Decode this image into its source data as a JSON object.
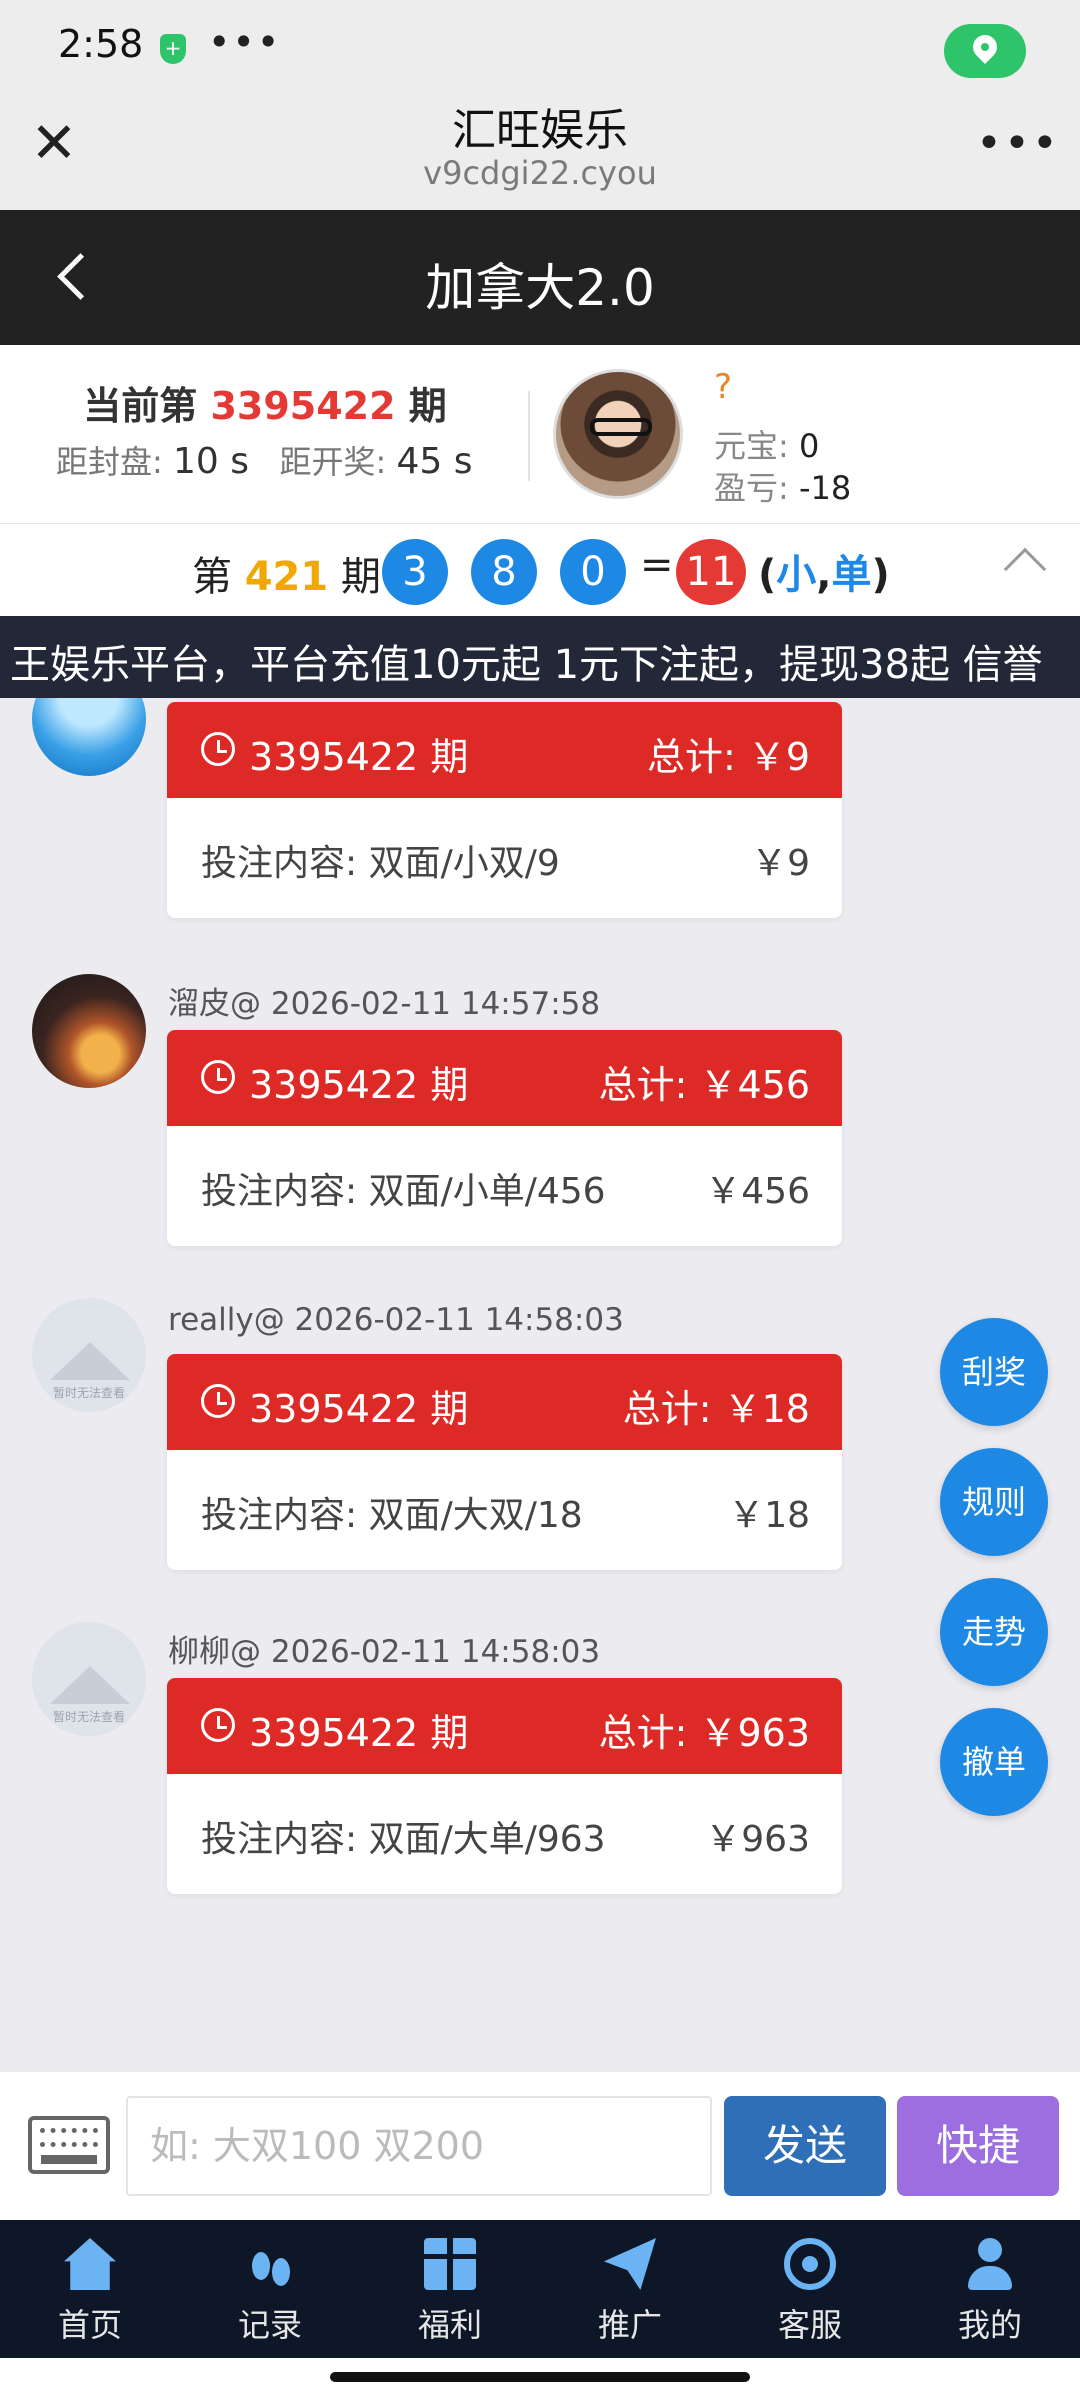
{
  "status": {
    "time": "2:58",
    "dots": "•••"
  },
  "wx": {
    "title": "汇旺娱乐",
    "domain": "v9cdgi22.cyou",
    "close": "✕",
    "more": "•••"
  },
  "nav": {
    "title": "加拿大2.0"
  },
  "info": {
    "period_prefix": "当前第",
    "period_num": "3395422",
    "period_suffix": "期",
    "close_label": "距封盘:",
    "close_val": "10 s",
    "draw_label": "距开奖:",
    "draw_val": "45 s",
    "username": "?",
    "yb_label": "元宝:",
    "yb_val": "0",
    "yk_label": "盈亏:",
    "yk_val": "-18"
  },
  "result": {
    "prefix": "第",
    "issue": "421",
    "suffix": "期",
    "balls": [
      "3",
      "8",
      "0"
    ],
    "eq": "=",
    "sum": "11",
    "attr_open": "(",
    "attr_a": "小",
    "comma": ",",
    "attr_b": "单",
    "attr_close": ")"
  },
  "marquee": {
    "text": "王娱乐平台，平台充值10元起 1元下注起，提现38起 信誉"
  },
  "messages": [
    {
      "meta": "",
      "issue": "3395422 期",
      "total": "总计: ￥9",
      "content": "投注内容: 双面/小双/9",
      "amount": "￥9"
    },
    {
      "meta": "溜皮@ 2026-02-11 14:57:58",
      "issue": "3395422 期",
      "total": "总计: ￥456",
      "content": "投注内容: 双面/小单/456",
      "amount": "￥456"
    },
    {
      "meta": "really@ 2026-02-11 14:58:03",
      "issue": "3395422 期",
      "total": "总计: ￥18",
      "content": "投注内容: 双面/大双/18",
      "amount": "￥18"
    },
    {
      "meta": "柳柳@ 2026-02-11 14:58:03",
      "issue": "3395422 期",
      "total": "总计: ￥963",
      "content": "投注内容: 双面/大单/963",
      "amount": "￥963"
    }
  ],
  "avatar_caption": "暂时无法查看",
  "fabs": [
    "刮奖",
    "规则",
    "走势",
    "撤单"
  ],
  "input": {
    "placeholder": "如: 大双100 双200",
    "send": "发送",
    "quick": "快捷"
  },
  "tabs": [
    "首页",
    "记录",
    "福利",
    "推广",
    "客服",
    "我的"
  ]
}
